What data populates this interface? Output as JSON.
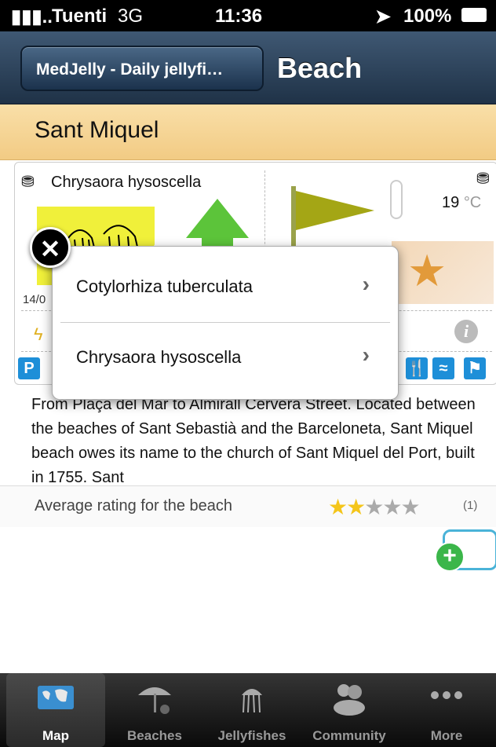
{
  "status_bar": {
    "carrier": "Tuenti",
    "network": "3G",
    "time": "11:36",
    "battery": "100%"
  },
  "nav": {
    "back_label": "MedJelly - Daily jellyfi…",
    "title": "Beach"
  },
  "beach": {
    "name": "Sant Miquel"
  },
  "card": {
    "species": "Chrysaora hysoscella",
    "temperature": "19",
    "temperature_unit": "°C",
    "date": "14/0",
    "amenity_p": "P"
  },
  "popover": {
    "items": [
      {
        "label": "Cotylorhiza tuberculata"
      },
      {
        "label": "Chrysaora hysoscella"
      }
    ]
  },
  "description": "From Plaça del Mar to Almirall Cervera Street. Located between the beaches of Sant Sebastià and the Barceloneta, Sant Miquel beach owes its name to the church of Sant Miquel del Port, built in 1755. Sant",
  "rating": {
    "label": "Average rating for the beach",
    "value": 2,
    "max": 5,
    "count": "(1)"
  },
  "tabs": [
    {
      "label": "Map",
      "active": true
    },
    {
      "label": "Beaches",
      "active": false
    },
    {
      "label": "Jellyfishes",
      "active": false
    },
    {
      "label": "Community",
      "active": false
    },
    {
      "label": "More",
      "active": false
    }
  ],
  "colors": {
    "accent_header": "#f2cb84",
    "nav_bg": "#2a4058",
    "flag": "#a4a615",
    "star": "#f4c51a"
  }
}
